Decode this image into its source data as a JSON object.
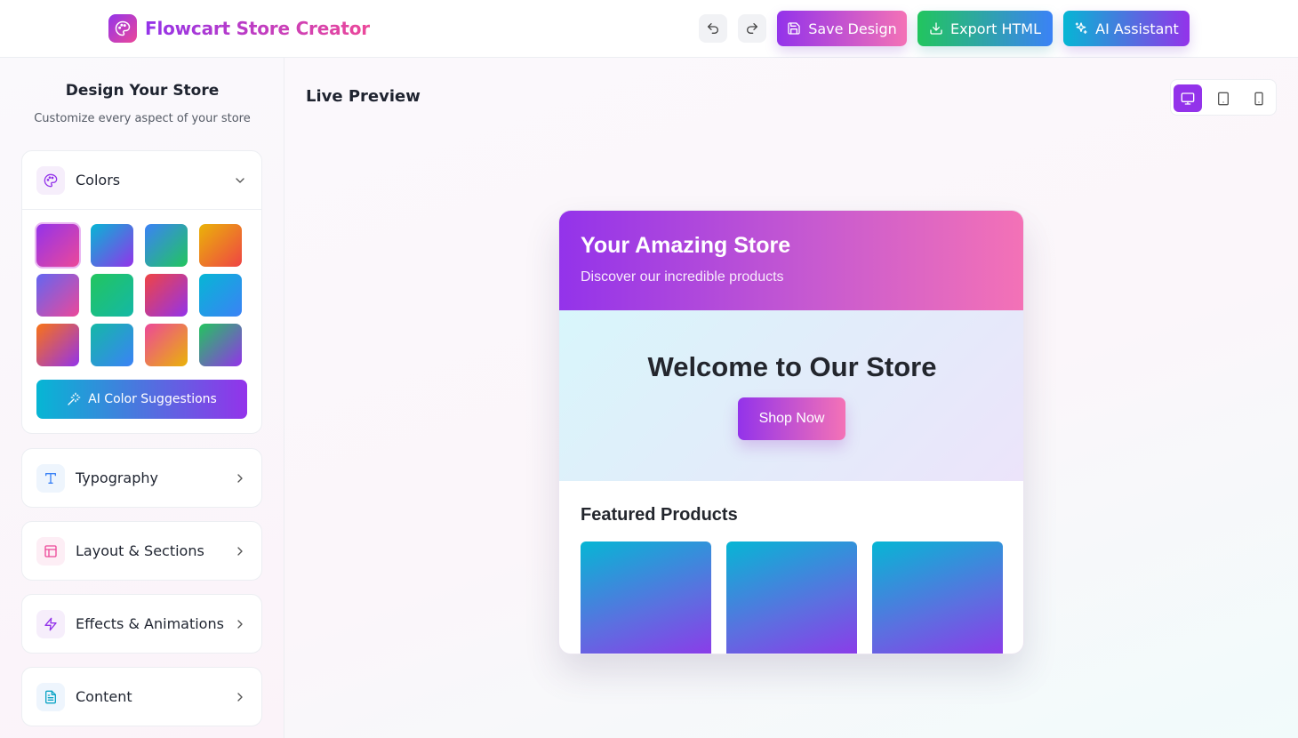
{
  "header": {
    "app_title": "Flowcart Store Creator",
    "icons": {
      "logo": "palette-icon",
      "undo": "undo-icon",
      "redo": "redo-icon"
    },
    "buttons": {
      "save": {
        "label": "Save Design",
        "icon": "save-icon"
      },
      "export": {
        "label": "Export HTML",
        "icon": "download-icon"
      },
      "ai": {
        "label": "AI Assistant",
        "icon": "sparkles-icon"
      }
    }
  },
  "sidebar": {
    "title": "Design Your Store",
    "subtitle": "Customize every aspect of your store",
    "sections": [
      {
        "label": "Colors",
        "icon": "palette-icon",
        "expanded": true
      },
      {
        "label": "Typography",
        "icon": "type-icon",
        "expanded": false
      },
      {
        "label": "Layout & Sections",
        "icon": "layout-icon",
        "expanded": false
      },
      {
        "label": "Effects & Animations",
        "icon": "zap-icon",
        "expanded": false
      },
      {
        "label": "Content",
        "icon": "file-text-icon",
        "expanded": false
      }
    ],
    "color_presets": [
      {
        "from": "#9333ea",
        "to": "#ec4899",
        "selected": true
      },
      {
        "from": "#06b6d4",
        "to": "#9333ea"
      },
      {
        "from": "#3b82f6",
        "to": "#22c55e"
      },
      {
        "from": "#eab308",
        "to": "#ef4444"
      },
      {
        "from": "#6366f1",
        "to": "#ec4899"
      },
      {
        "from": "#22c55e",
        "to": "#14b8a6"
      },
      {
        "from": "#ef4444",
        "to": "#9333ea"
      },
      {
        "from": "#06b6d4",
        "to": "#3b82f6"
      },
      {
        "from": "#f97316",
        "to": "#9333ea"
      },
      {
        "from": "#14b8a6",
        "to": "#3b82f6"
      },
      {
        "from": "#ec4899",
        "to": "#eab308"
      },
      {
        "from": "#22c55e",
        "to": "#9333ea"
      }
    ],
    "ai_colors_button": {
      "label": "AI Color Suggestions",
      "icon": "wand-icon"
    }
  },
  "preview": {
    "title": "Live Preview",
    "devices": [
      {
        "name": "desktop-icon",
        "active": true
      },
      {
        "name": "tablet-icon",
        "active": false
      },
      {
        "name": "mobile-icon",
        "active": false
      }
    ],
    "store": {
      "name": "Your Amazing Store",
      "tagline": "Discover our incredible products",
      "hero_title": "Welcome to Our Store",
      "cta": "Shop Now",
      "featured_title": "Featured Products",
      "product_count": 3
    }
  },
  "colors": {
    "brand_purple": "#9333ea",
    "brand_pink": "#ec4899",
    "export_green": "#22c55e",
    "export_blue": "#3b82f6",
    "ai_cyan": "#06b6d4"
  }
}
